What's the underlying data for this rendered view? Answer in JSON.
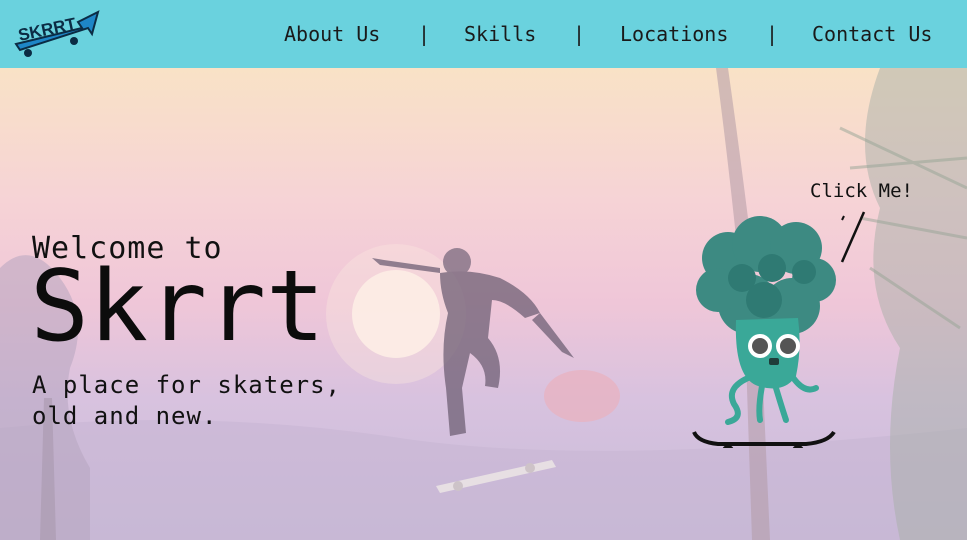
{
  "header": {
    "logo_text": "SKRRT",
    "nav": [
      {
        "label": "About Us"
      },
      {
        "label": "Skills"
      },
      {
        "label": "Locations"
      },
      {
        "label": "Contact Us"
      }
    ],
    "separator": "|"
  },
  "hero": {
    "welcome": "Welcome to",
    "brand": "Skrrt",
    "tagline": "A place for skaters, old and new.",
    "click_me": "Click Me!"
  },
  "icons": {
    "logo": "skateboard-arrow-logo",
    "mascot": "broccoli-skateboard-mascot"
  },
  "colors": {
    "header_bg": "#6ad2de",
    "logo_blue": "#1e86c7",
    "mascot_teal": "#3aa898",
    "mascot_dark": "#2f7f78"
  }
}
